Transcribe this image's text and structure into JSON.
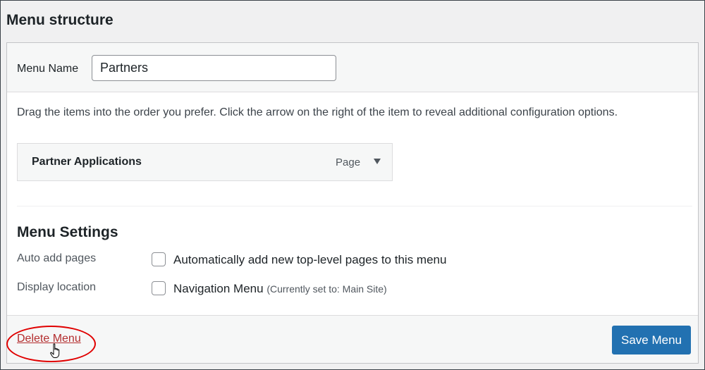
{
  "section_title": "Menu structure",
  "menu_name": {
    "label": "Menu Name",
    "value": "Partners"
  },
  "instructions": "Drag the items into the order you prefer. Click the arrow on the right of the item to reveal additional configuration options.",
  "menu_items": [
    {
      "title": "Partner Applications",
      "type": "Page",
      "toggle_icon": "triangle-down-icon"
    }
  ],
  "settings": {
    "title": "Menu Settings",
    "auto_add": {
      "label": "Auto add pages",
      "checkbox_label": "Automatically add new top-level pages to this menu",
      "checked": false
    },
    "display_location": {
      "label": "Display location",
      "checkbox_label": "Navigation Menu",
      "note": "(Currently set to: Main Site)",
      "checked": false
    }
  },
  "footer": {
    "delete_label": "Delete Menu",
    "save_label": "Save Menu"
  },
  "colors": {
    "primary": "#2271b1",
    "delete": "#b32d2e",
    "callout": "#e00000"
  }
}
